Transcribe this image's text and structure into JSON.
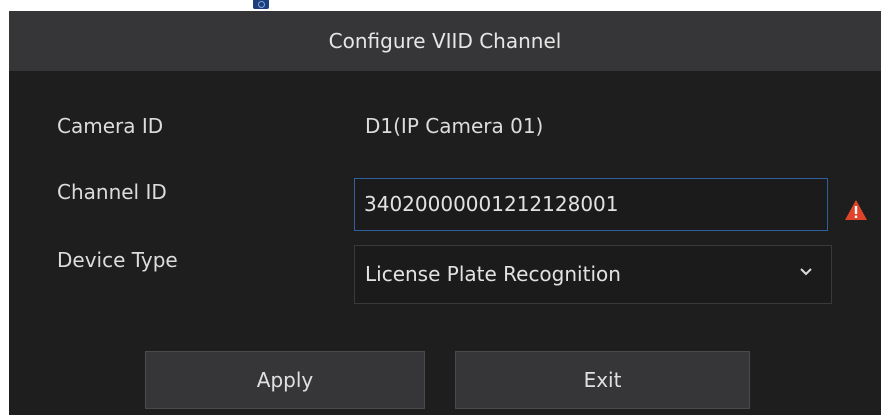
{
  "dialog": {
    "title": "Configure VIID Channel"
  },
  "form": {
    "camera_id_label": "Camera ID",
    "camera_id_value": "D1(IP Camera 01)",
    "channel_id_label": "Channel ID",
    "channel_id_value": "34020000001212128001",
    "device_type_label": "Device Type",
    "device_type_value": "License Plate Recognition"
  },
  "buttons": {
    "apply": "Apply",
    "exit": "Exit"
  },
  "icons": {
    "warning": "warning-triangle-icon",
    "dropdown": "chevron-down-icon",
    "app": "app-icon"
  },
  "colors": {
    "dialog_bg": "#1e1e1f",
    "titlebar_bg": "#363638",
    "input_focus_border": "#2f5f9e",
    "warning": "#e0452b"
  }
}
